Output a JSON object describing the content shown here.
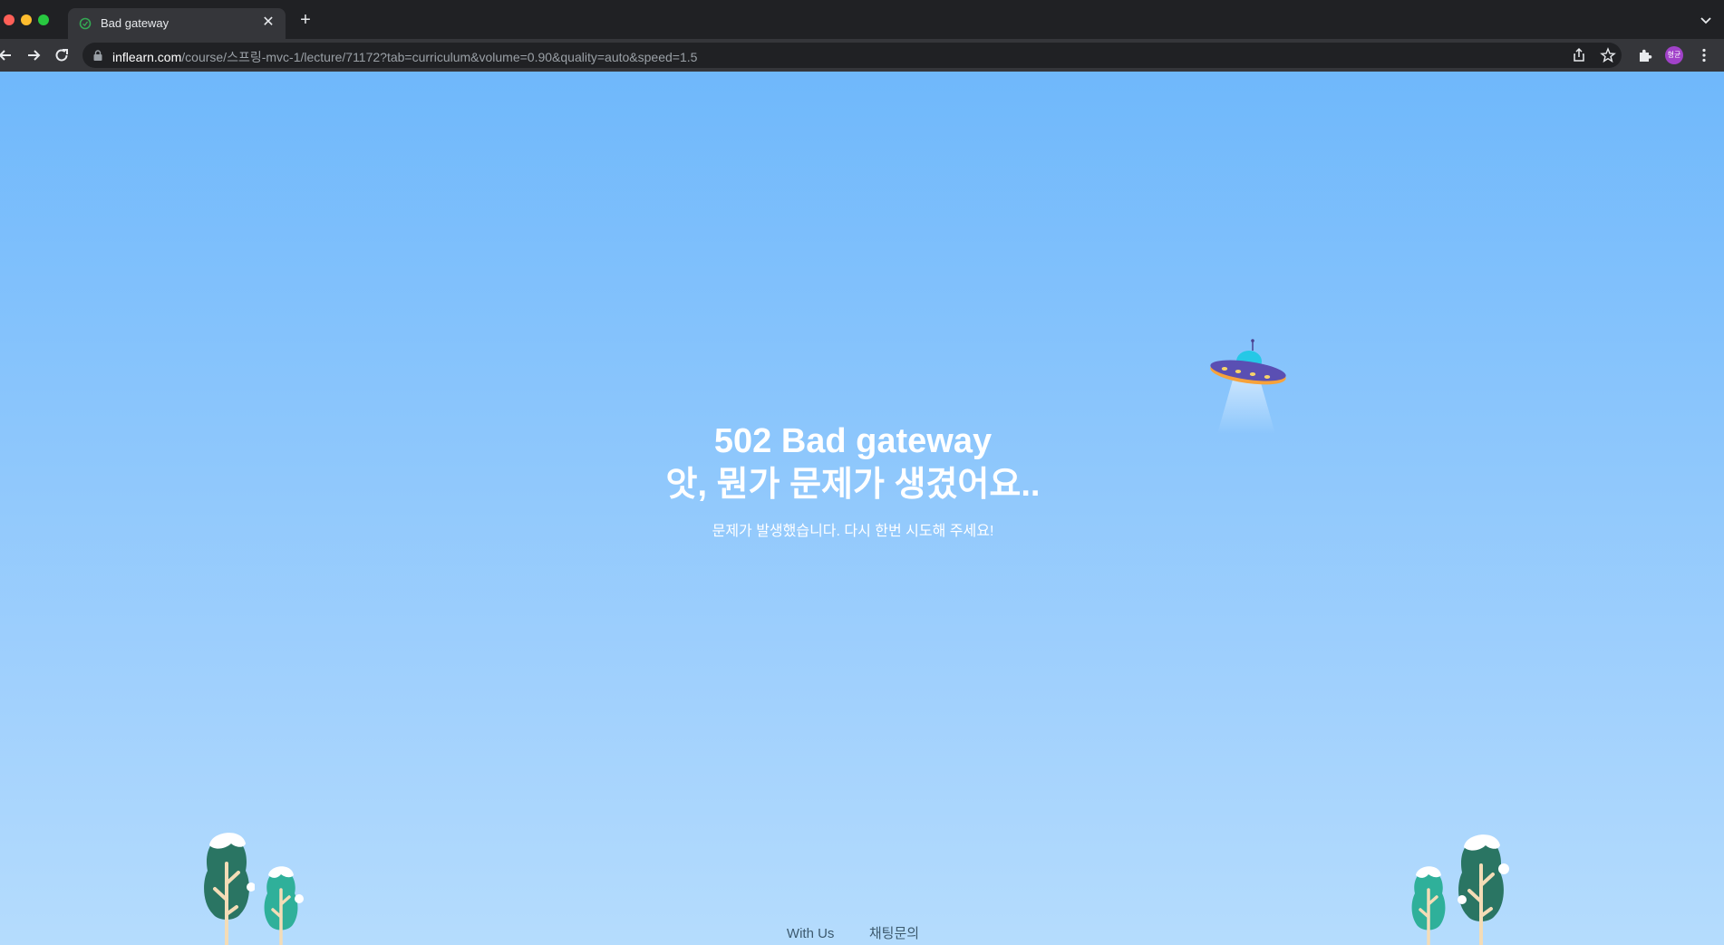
{
  "browser": {
    "tab": {
      "title": "Bad gateway"
    },
    "url_host": "inflearn.com",
    "url_path": "/course/스프링-mvc-1/lecture/71172?tab=curriculum&volume=0.90&quality=auto&speed=1.5",
    "profile_initials": "형균"
  },
  "error": {
    "title": "502 Bad gateway",
    "subtitle": "앗, 뭔가 문제가 생겼어요..",
    "message": "문제가 발생했습니다. 다시 한번 시도해 주세요!"
  },
  "footer": {
    "links": [
      {
        "label": "With Us"
      },
      {
        "label": "채팅문의"
      }
    ]
  },
  "colors": {
    "sky_top": "#6fb8fb",
    "sky_bottom": "#b5dcfd",
    "tree_dark": "#2a7563",
    "tree_light": "#2fb09a",
    "snow": "#ffffff",
    "ufo_body": "#5a4fb3"
  },
  "icons": [
    "back-arrow-icon",
    "forward-arrow-icon",
    "reload-icon",
    "lock-icon",
    "share-icon",
    "star-icon",
    "extensions-icon",
    "menu-dots-icon",
    "tab-search-icon",
    "close-icon",
    "plus-icon",
    "ufo-illustration",
    "tree-illustration"
  ]
}
